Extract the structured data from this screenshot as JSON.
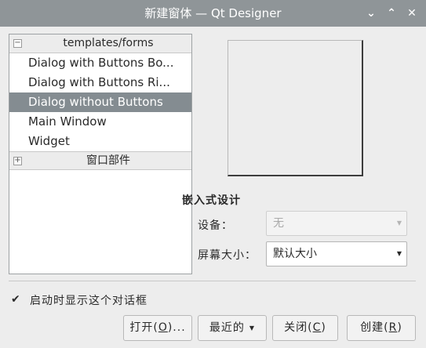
{
  "window": {
    "title": "新建窗体 — Qt Designer",
    "minimize_glyph": "⌄",
    "maximize_glyph": "⌃",
    "close_glyph": "✕"
  },
  "tree": {
    "category1": {
      "label": "templates/forms",
      "expander": "−"
    },
    "items": [
      {
        "label": "Dialog with Buttons Bo..."
      },
      {
        "label": "Dialog with Buttons Ri..."
      },
      {
        "label": "Dialog without Buttons",
        "selected": true
      },
      {
        "label": "Main Window"
      },
      {
        "label": "Widget"
      }
    ],
    "category2": {
      "label": "窗口部件",
      "expander": "+"
    }
  },
  "embedded": {
    "title": "嵌入式设计",
    "device_label": "设备：",
    "device_value": "无",
    "screen_label": "屏幕大小：",
    "screen_value": "默认大小"
  },
  "startup_check": {
    "checked": true,
    "glyph": "✔",
    "label": "启动时显示这个对话框"
  },
  "buttons": {
    "open_prefix": "打开(",
    "open_mnemonic": "O",
    "open_suffix": ")...",
    "recent": "最近的",
    "close_prefix": "关闭(",
    "close_mnemonic": "C",
    "close_suffix": ")",
    "create_prefix": "创建(",
    "create_mnemonic": "R",
    "create_suffix": ")",
    "dropdown_glyph": "▼"
  },
  "colors": {
    "titlebar": "#8f9598",
    "selection": "#848c91",
    "background": "#ededed"
  }
}
